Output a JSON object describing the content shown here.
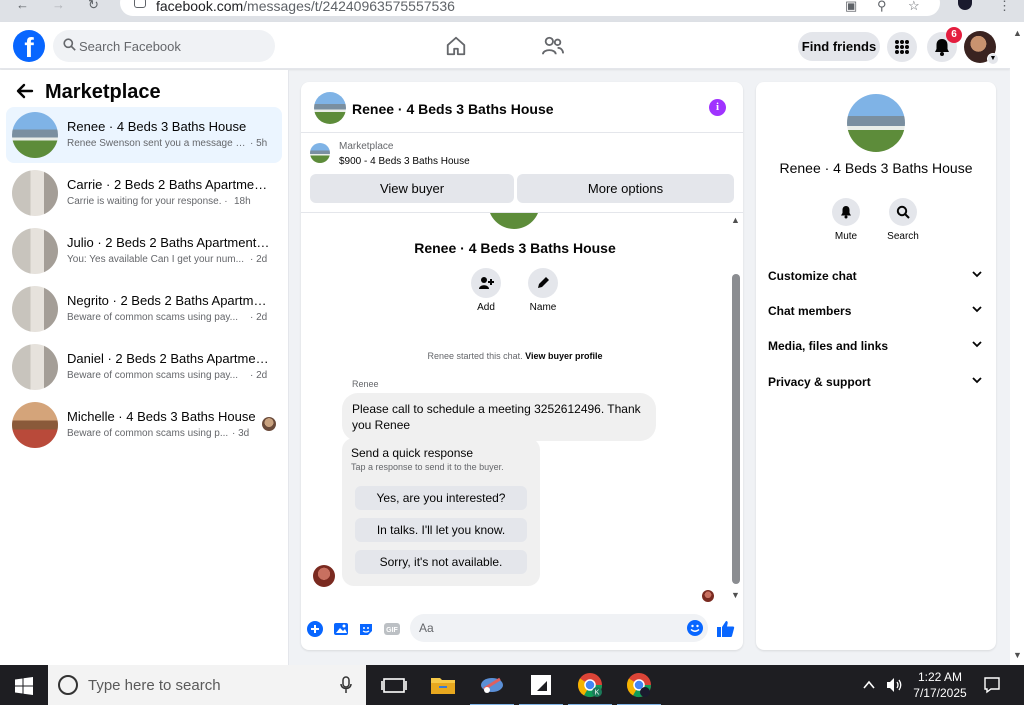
{
  "browser": {
    "url_domain": "facebook.com",
    "url_path": "/messages/t/24240963575557536"
  },
  "header": {
    "search_placeholder": "Search Facebook",
    "find_friends_label": "Find friends",
    "notification_count": "6"
  },
  "sidebar": {
    "title": "Marketplace",
    "conversations": [
      {
        "name": "Renee · 4 Beds 3 Baths House",
        "snippet": "Renee Swenson sent you a message a...",
        "time": "· 5h",
        "thumb": "house"
      },
      {
        "name": "Carrie · 2 Beds 2 Baths Apartment/...",
        "snippet": "Carrie is waiting for your response. ·",
        "time": "18h",
        "thumb": "room"
      },
      {
        "name": "Julio · 2 Beds 2 Baths Apartment/c...",
        "snippet": "You: Yes available Can I get your num...",
        "time": "· 2d",
        "thumb": "room"
      },
      {
        "name": "Negrito · 2 Beds 2 Baths Apartmen...",
        "snippet": "Beware of common scams using pay...",
        "time": "· 2d",
        "thumb": "room"
      },
      {
        "name": "Daniel · 2 Beds 2 Baths Apartment...",
        "snippet": "Beware of common scams using pay...",
        "time": "· 2d",
        "thumb": "room"
      },
      {
        "name": "Michelle · 4 Beds 3 Baths House",
        "snippet": "Beware of common scams using p...",
        "time": "· 3d",
        "thumb": "room2"
      }
    ]
  },
  "chat": {
    "title": "Renee · 4 Beds 3 Baths House",
    "marketplace_label": "Marketplace",
    "listing": "$900 - 4 Beds 3 Baths House",
    "view_buyer_label": "View buyer",
    "more_options_label": "More options",
    "center_title": "Renee · 4 Beds 3 Baths House",
    "add_label": "Add",
    "name_label": "Name",
    "started_text": "Renee started this chat.",
    "view_profile_label": "View buyer profile",
    "sender": "Renee",
    "message": "Please call to schedule a meeting 3252612496. Thank you Renee",
    "quick_title": "Send a quick response",
    "quick_subtitle": "Tap a response to send it to the buyer.",
    "quick_responses": [
      "Yes, are you interested?",
      "In talks. I'll let you know.",
      "Sorry, it's not available."
    ],
    "composer_placeholder": "Aa"
  },
  "details": {
    "title": "Renee · 4 Beds 3 Baths House",
    "mute_label": "Mute",
    "search_label": "Search",
    "sections": [
      "Customize chat",
      "Chat members",
      "Media, files and links",
      "Privacy & support"
    ]
  },
  "taskbar": {
    "search_placeholder": "Type here to search",
    "time": "1:22 AM",
    "date": "7/17/2025"
  },
  "colors": {
    "brand_blue": "#0866ff",
    "active_bg": "#ebf5ff",
    "info_purple": "#a033ff"
  }
}
